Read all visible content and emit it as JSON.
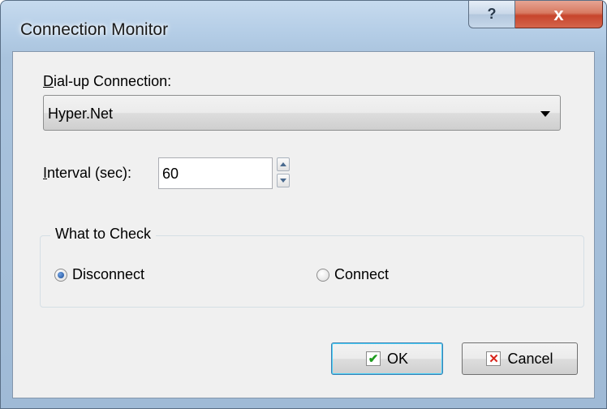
{
  "window": {
    "title": "Connection Monitor",
    "help_glyph": "?",
    "close_glyph": "x"
  },
  "connection": {
    "label_accel": "D",
    "label_rest": "ial-up Connection:",
    "value": "Hyper.Net"
  },
  "interval": {
    "label_accel": "I",
    "label_rest": "nterval (sec):",
    "value": "60"
  },
  "check_group": {
    "title": "What to Check",
    "options": [
      {
        "label": "Disconnect",
        "selected": true
      },
      {
        "label": "Connect",
        "selected": false
      }
    ]
  },
  "buttons": {
    "ok": "OK",
    "cancel": "Cancel"
  },
  "icons": {
    "ok": "checkmark-icon",
    "cancel": "x-mark-icon"
  }
}
